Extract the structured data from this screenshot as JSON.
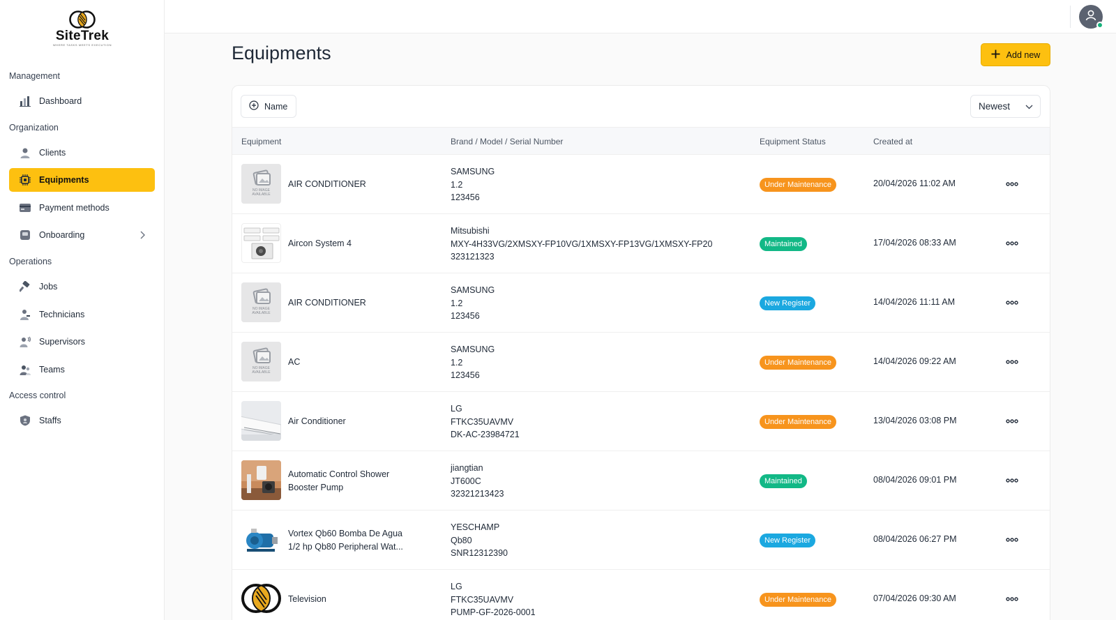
{
  "brand": {
    "name": "SiteTrek",
    "tagline": "WHERE TASKS MEETS EXECUTION"
  },
  "sidebar": {
    "sections": [
      {
        "title": "Management"
      },
      {
        "title": "Organization"
      },
      {
        "title": "Operations"
      },
      {
        "title": "Access control"
      }
    ],
    "items": [
      {
        "label": "Dashboard",
        "icon": "bar-chart-icon"
      },
      {
        "label": "Clients",
        "icon": "user-icon"
      },
      {
        "label": "Equipments",
        "icon": "chip-icon",
        "active": true
      },
      {
        "label": "Payment methods",
        "icon": "card-icon"
      },
      {
        "label": "Onboarding",
        "icon": "onboarding-icon"
      },
      {
        "label": "Jobs",
        "icon": "hammer-icon"
      },
      {
        "label": "Technicians",
        "icon": "technician-icon"
      },
      {
        "label": "Supervisors",
        "icon": "supervisor-icon"
      },
      {
        "label": "Teams",
        "icon": "team-icon"
      },
      {
        "label": "Staffs",
        "icon": "shield-icon"
      }
    ]
  },
  "header": {
    "title": "Equipments",
    "add_label": "Add new"
  },
  "toolbar": {
    "filter_label": "Name",
    "sort_value": "Newest"
  },
  "table": {
    "columns": [
      "Equipment",
      "Brand / Model / Serial Number",
      "Equipment Status",
      "Created at"
    ],
    "rows": [
      {
        "name": "AIR CONDITIONER",
        "brand": "SAMSUNG",
        "model": "1.2",
        "serial": "123456",
        "status": "Under Maintenance",
        "created": "20/04/2026 11:02 AM",
        "image": "no-image"
      },
      {
        "name": "Aircon System 4",
        "brand": "Mitsubishi",
        "model": "MXY-4H33VG/2XMSXY-FP10VG/1XMSXY-FP13VG/1XMSXY-FP20",
        "serial": "323121323",
        "status": "Maintained",
        "created": "17/04/2026 08:33 AM",
        "image": "aircon-system"
      },
      {
        "name": "AIR CONDITIONER",
        "brand": "SAMSUNG",
        "model": "1.2",
        "serial": "123456",
        "status": "New Register",
        "created": "14/04/2026 11:11 AM",
        "image": "no-image"
      },
      {
        "name": "AC",
        "brand": "SAMSUNG",
        "model": "1.2",
        "serial": "123456",
        "status": "Under Maintenance",
        "created": "14/04/2026 09:22 AM",
        "image": "no-image"
      },
      {
        "name": "Air Conditioner",
        "brand": "LG",
        "model": "FTKC35UAVMV",
        "serial": "DK-AC-23984721",
        "status": "Under Maintenance",
        "created": "13/04/2026 03:08 PM",
        "image": "wall-ac"
      },
      {
        "name_line1": "Automatic Control Shower",
        "name_line2": "Booster Pump",
        "brand": "jiangtian",
        "model": "JT600C",
        "serial": "32321213423",
        "status": "Maintained",
        "created": "08/04/2026 09:01 PM",
        "image": "pump-room"
      },
      {
        "name_line1": "Vortex Qb60 Bomba De Agua",
        "name_line2": "1/2 hp Qb80 Peripheral Wat...",
        "brand": "YESCHAMP",
        "model": "Qb80",
        "serial": "SNR12312390",
        "status": "New Register",
        "created": "08/04/2026 06:27 PM",
        "image": "water-pump"
      },
      {
        "name": "Television",
        "brand": "LG",
        "model": "FTKC35UAVMV",
        "serial": "PUMP-GF-2026-0001",
        "status": "Under Maintenance",
        "created": "07/04/2026 09:30 AM",
        "image": "logo"
      }
    ]
  },
  "no_image_text": {
    "line1": "NO IMAGE",
    "line2": "AVAILABLE"
  },
  "colors": {
    "accent": "#fdc010",
    "under_maintenance": "#f7941d",
    "maintained": "#12b886",
    "new_register": "#1ba8e0"
  }
}
